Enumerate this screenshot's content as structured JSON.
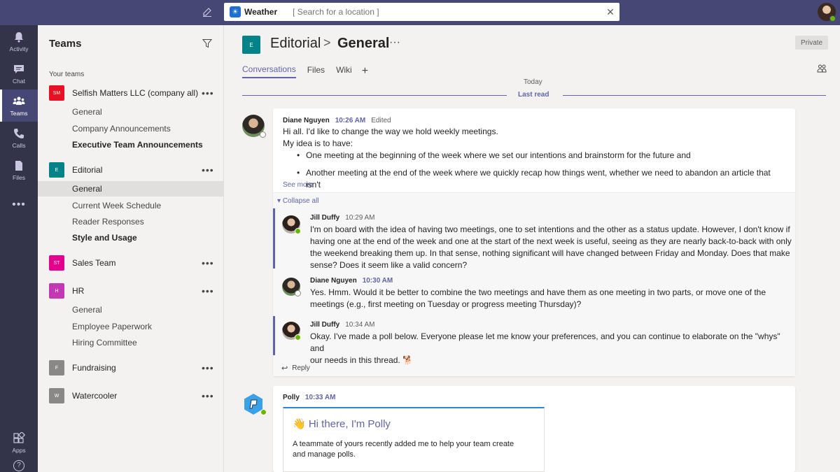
{
  "topbar": {
    "app_chip": "Weather",
    "search_placeholder": "[ Search for a location ]",
    "brand_color": "#464775"
  },
  "rail": {
    "items": [
      {
        "label": "Activity",
        "icon": "bell-icon"
      },
      {
        "label": "Chat",
        "icon": "chat-icon"
      },
      {
        "label": "Teams",
        "icon": "teams-icon",
        "active": true
      },
      {
        "label": "Calls",
        "icon": "phone-icon"
      },
      {
        "label": "Files",
        "icon": "file-icon"
      },
      {
        "label": "",
        "icon": "more-icon"
      },
      {
        "label": "Apps",
        "icon": "apps-icon"
      }
    ]
  },
  "teams_panel": {
    "title": "Teams",
    "section_label": "Your teams",
    "teams": [
      {
        "badge": "SM",
        "color": "#e81123",
        "name": "Selfish Matters LLC (company all)",
        "channels": [
          {
            "name": "General"
          },
          {
            "name": "Company Announcements"
          },
          {
            "name": "Executive Team Announcements",
            "bold": true
          }
        ]
      },
      {
        "badge": "E",
        "color": "#038387",
        "name": "Editorial",
        "channels": [
          {
            "name": "General",
            "selected": true
          },
          {
            "name": "Current Week Schedule"
          },
          {
            "name": "Reader Responses"
          },
          {
            "name": "Style and Usage",
            "bold": true
          }
        ]
      },
      {
        "badge": "ST",
        "color": "#e3008c",
        "name": "Sales Team",
        "channels": []
      },
      {
        "badge": "H",
        "color": "#c239b3",
        "name": "HR",
        "channels": [
          {
            "name": "General"
          },
          {
            "name": "Employee Paperwork"
          },
          {
            "name": "Hiring Committee"
          }
        ]
      },
      {
        "badge": "F",
        "color": "#8a8886",
        "name": "Fundraising",
        "channels": []
      },
      {
        "badge": "W",
        "color": "#8a8886",
        "name": "Watercooler",
        "channels": []
      }
    ]
  },
  "channel_header": {
    "badge": "E",
    "team": "Editorial",
    "separator": ">",
    "channel": "General",
    "more": "···",
    "private_label": "Private",
    "tabs": [
      "Conversations",
      "Files",
      "Wiki"
    ],
    "add_tab": "+"
  },
  "feed": {
    "today_label": "Today",
    "last_read_label": "Last read",
    "accent": "#6264a7",
    "post": {
      "author": "Diane Nguyen",
      "time": "10:26 AM",
      "edited": "Edited",
      "line1": "Hi all. I'd like to change the way we hold weekly meetings.",
      "line2": "My idea is to have:",
      "bullets": [
        "One meeting at the beginning of the week where we set our intentions and brainstorm for the future and",
        "Another meeting at the end of the week where we quickly recap how things went, whether we need to abandon an article that isn't"
      ],
      "see_more": "See more",
      "collapse_all": "Collapse all",
      "reply_label": "Reply"
    },
    "replies": [
      {
        "author": "Jill Duffy",
        "time": "10:29 AM",
        "unread": false,
        "lines": [
          "I'm on board with the idea of having two meetings, one to set intentions and the other as a status update. However, I don't know if",
          "having one at the end of the week and one at the start of the next week is useful, seeing as they are nearly back-to-back with only",
          "the weekend breaking them up. In that sense, nothing significant will have changed between Friday and Monday. Does that make",
          "sense? Does it seem like a valid concern?"
        ]
      },
      {
        "author": "Diane Nguyen",
        "time": "10:30 AM",
        "unread": true,
        "lines": [
          "Yes. Hmm. Would it be better to combine the two meetings and have them as one meeting in two parts, or move one of the",
          "meetings (e.g., first meeting on Tuesday or progress meeting Thursday)?"
        ]
      },
      {
        "author": "Jill Duffy",
        "time": "10:34 AM",
        "unread": false,
        "lines": [
          "Okay. I've made a poll below. Everyone please let me know your preferences, and you can continue to elaborate on the \"whys\" and",
          "our needs in this thread. 🐕"
        ]
      }
    ],
    "polly": {
      "author": "Polly",
      "time": "10:33 AM",
      "card_title": "👋 Hi there, I'm Polly",
      "card_text": [
        "A teammate of yours recently added me to help your team create",
        "and manage polls."
      ]
    }
  }
}
